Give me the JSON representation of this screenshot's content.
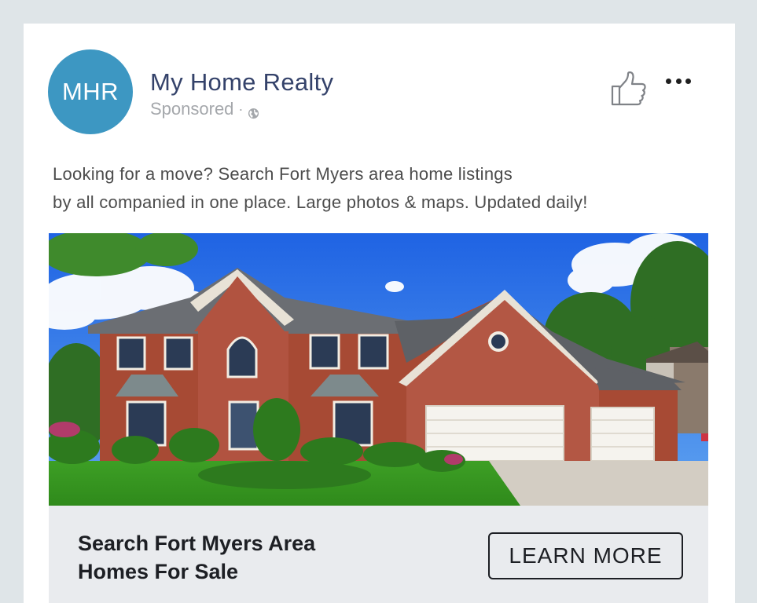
{
  "post": {
    "avatar_initials": "MHR",
    "page_name": "My Home Realty",
    "sponsored_label": "Sponsored",
    "separator": "·",
    "body_lines": [
      "Looking for a move? Search Fort Myers area home listings",
      "by all companied in one place. Large photos & maps. Updated daily!"
    ]
  },
  "cta": {
    "headline_lines": [
      "Search Fort Myers Area",
      "Homes For Sale"
    ],
    "button_label": "LEARN MORE"
  },
  "colors": {
    "brand_blue": "#3d97c2",
    "page_name": "#34426a",
    "frame_bg": "#dfe5e8",
    "cta_bg": "#e9ebee"
  },
  "icons": {
    "like": "thumbs-up-icon",
    "more": "more-options-icon",
    "audience": "globe-icon"
  }
}
